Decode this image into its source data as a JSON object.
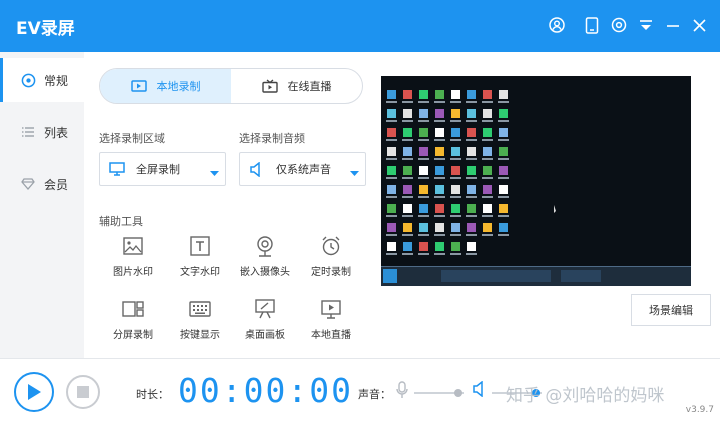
{
  "app": {
    "title": "EV录屏",
    "version": "v3.9.7"
  },
  "titlebar_icons": [
    "user-icon",
    "phone-icon",
    "settings-icon",
    "menu-icon",
    "minimize-icon",
    "close-icon"
  ],
  "sidebar": {
    "items": [
      {
        "label": "常规",
        "icon": "settings-icon",
        "active": true
      },
      {
        "label": "列表",
        "icon": "list-icon",
        "active": false
      },
      {
        "label": "会员",
        "icon": "diamond-icon",
        "active": false
      }
    ]
  },
  "mode": {
    "local": "本地录制",
    "live": "在线直播",
    "active": "local"
  },
  "area": {
    "label": "选择录制区域",
    "value": "全屏录制"
  },
  "audio": {
    "label": "选择录制音频",
    "value": "仅系统声音"
  },
  "tools": {
    "label": "辅助工具",
    "items": [
      {
        "label": "图片水印",
        "icon": "image-icon"
      },
      {
        "label": "文字水印",
        "icon": "text-icon"
      },
      {
        "label": "嵌入摄像头",
        "icon": "webcam-icon"
      },
      {
        "label": "定时录制",
        "icon": "alarm-icon"
      },
      {
        "label": "分屏录制",
        "icon": "split-screen-icon"
      },
      {
        "label": "按键显示",
        "icon": "keyboard-icon"
      },
      {
        "label": "桌面画板",
        "icon": "easel-icon"
      },
      {
        "label": "本地直播",
        "icon": "monitor-play-icon"
      }
    ]
  },
  "scene_button": "场景编辑",
  "bottom": {
    "duration_label": "时长：",
    "timer": "00:00:00",
    "volume_label": "声音：",
    "mic_level": 0.85,
    "speaker_level": 0.85
  },
  "watermark": "知乎 @刘哈哈的妈咪",
  "colors": {
    "accent": "#1d93f0",
    "sidebar_bg": "#f3f4f6",
    "preview_bg": "#0a0f14"
  }
}
